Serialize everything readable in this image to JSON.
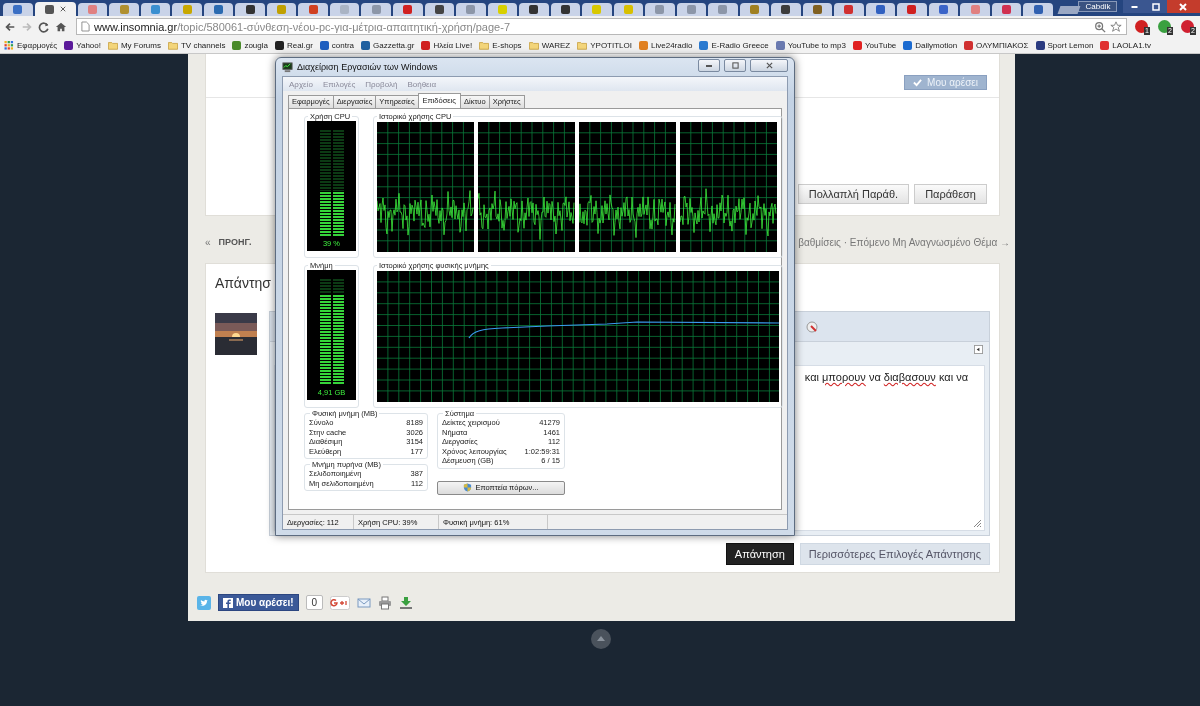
{
  "browser": {
    "tabs": [
      {
        "selected": false,
        "color": "#3a6fc4"
      },
      {
        "selected": true,
        "color": "#555555"
      },
      {
        "selected": false,
        "color": "#e08080"
      },
      {
        "selected": false,
        "color": "#b09030"
      },
      {
        "selected": false,
        "color": "#3a8fd0"
      },
      {
        "selected": false,
        "color": "#c8a800"
      },
      {
        "selected": false,
        "color": "#2a6ab0"
      },
      {
        "selected": false,
        "color": "#333333"
      },
      {
        "selected": false,
        "color": "#c0a000"
      },
      {
        "selected": false,
        "color": "#d04020"
      },
      {
        "selected": false,
        "color": "#aab4c4"
      },
      {
        "selected": false,
        "color": "#8c96a8"
      },
      {
        "selected": false,
        "color": "#d02020"
      },
      {
        "selected": false,
        "color": "#444444"
      },
      {
        "selected": false,
        "color": "#8c96a8"
      },
      {
        "selected": false,
        "color": "#d8d000"
      },
      {
        "selected": false,
        "color": "#333333"
      },
      {
        "selected": false,
        "color": "#333333"
      },
      {
        "selected": false,
        "color": "#d8c800"
      },
      {
        "selected": false,
        "color": "#d8c000"
      },
      {
        "selected": false,
        "color": "#8c96a8"
      },
      {
        "selected": false,
        "color": "#8c96a8"
      },
      {
        "selected": false,
        "color": "#8c96a8"
      },
      {
        "selected": false,
        "color": "#a08020"
      },
      {
        "selected": false,
        "color": "#3c3c3c"
      },
      {
        "selected": false,
        "color": "#806020"
      },
      {
        "selected": false,
        "color": "#d03030"
      },
      {
        "selected": false,
        "color": "#3060c0"
      },
      {
        "selected": false,
        "color": "#d02020"
      },
      {
        "selected": false,
        "color": "#3a64c8"
      },
      {
        "selected": false,
        "color": "#e08080"
      },
      {
        "selected": false,
        "color": "#d03050"
      },
      {
        "selected": false,
        "color": "#3060b0"
      }
    ],
    "profile": "Cabdik",
    "url": {
      "host": "www.insomnia.gr",
      "path": "/topic/580061-σύνθεση-νέου-pc-για-μέτρια-απαιτητική-χρήση/page-7"
    },
    "extensions": [
      {
        "color": "#d02020",
        "badge": "1"
      },
      {
        "color": "#3aa040",
        "badge": "2"
      },
      {
        "color": "#d02030",
        "badge": "2"
      }
    ],
    "bookmarks": [
      {
        "kind": "apps",
        "label": "Εφαρμογές"
      },
      {
        "kind": "site",
        "label": "Yahoo!",
        "color": "#5b1a9a"
      },
      {
        "kind": "folder",
        "label": "My Forums"
      },
      {
        "kind": "folder",
        "label": "TV channels"
      },
      {
        "kind": "site",
        "label": "zougla",
        "color": "#4a8a2a"
      },
      {
        "kind": "site",
        "label": "Real.gr",
        "color": "#222222"
      },
      {
        "kind": "site",
        "label": "contra",
        "color": "#1f5fbf"
      },
      {
        "kind": "site",
        "label": "Gazzetta.gr",
        "color": "#2060a0"
      },
      {
        "kind": "site",
        "label": "Ηλεία Live!",
        "color": "#d02020"
      },
      {
        "kind": "folder",
        "label": "E-shops"
      },
      {
        "kind": "folder",
        "label": "WAREZ"
      },
      {
        "kind": "folder",
        "label": "YPOTITLOI"
      },
      {
        "kind": "site",
        "label": "Live24radio",
        "color": "#e08020"
      },
      {
        "kind": "site",
        "label": "E-Radio Greece",
        "color": "#2a7ad0"
      },
      {
        "kind": "site",
        "label": "YouTube to mp3",
        "color": "#6a7ab0"
      },
      {
        "kind": "site",
        "label": "YouTube",
        "color": "#e02020"
      },
      {
        "kind": "site",
        "label": "Dailymotion",
        "color": "#1a6ad0"
      },
      {
        "kind": "site",
        "label": "ΟΛΥΜΠΙΑΚΟΣ",
        "color": "#d03030"
      },
      {
        "kind": "site",
        "label": "Sport Lemon",
        "color": "#2a3a80"
      },
      {
        "kind": "site",
        "label": "LAOLA1.tv",
        "color": "#e03030"
      }
    ]
  },
  "post": {
    "like_button": "Μου αρέσει",
    "buttons": [
      "Πολλαπλή Παράθ.",
      "Παράθεση"
    ]
  },
  "navigation": {
    "back_arrow": "«",
    "previous": "ΠΡΟΗΓ.",
    "next": "βαθμίσεις · Επόμενο Μη Αναγνωσμένο Θέμα →"
  },
  "reply": {
    "heading": "Απάντησ",
    "editor_words": [
      {
        "text": "και",
        "misspelled": false
      },
      {
        "text": "μπορουν",
        "misspelled": true
      },
      {
        "text": "να",
        "misspelled": false
      },
      {
        "text": "διαβασουν",
        "misspelled": true
      },
      {
        "text": "και",
        "misspelled": false
      },
      {
        "text": "να",
        "misspelled": false
      }
    ],
    "buttons": [
      {
        "label": "Απάντηση",
        "primary": true
      },
      {
        "label": "Περισσότερες Επιλογές Απάντησης",
        "primary": false
      }
    ]
  },
  "share": {
    "like_button": "Μου αρέσει!",
    "like_count": "0"
  },
  "task_manager": {
    "title": "Διαχείριση Εργασιών των Windows",
    "menu": [
      "Αρχείο",
      "Επιλογές",
      "Προβολή",
      "Βοήθεια"
    ],
    "tabs": [
      {
        "label": "Εφαρμογές",
        "selected": false
      },
      {
        "label": "Διεργασίες",
        "selected": false
      },
      {
        "label": "Υπηρεσίες",
        "selected": false
      },
      {
        "label": "Επιδόσεις",
        "selected": true
      },
      {
        "label": "Δίκτυο",
        "selected": false
      },
      {
        "label": "Χρήστες",
        "selected": false
      }
    ],
    "cpu_usage": {
      "label": "Χρήση CPU",
      "level": 0.42,
      "reading": "39 %"
    },
    "cpu_history": {
      "label": "Ιστορικό χρήσης CPU"
    },
    "memory": {
      "label": "Μνήμη",
      "level": 0.85,
      "reading": "4,91 GB"
    },
    "memory_history": {
      "label": "Ιστορικό χρήσης φυσικής μνήμης"
    },
    "physical_memory": {
      "label": "Φυσική μνήμη (MB)",
      "rows": [
        {
          "name": "Σύνολο",
          "value": "8189"
        },
        {
          "name": "Στην cache",
          "value": "3026"
        },
        {
          "name": "Διαθέσιμη",
          "value": "3154"
        },
        {
          "name": "Ελεύθερη",
          "value": "177"
        }
      ]
    },
    "kernel_memory": {
      "label": "Μνήμη πυρήνα (MB)",
      "rows": [
        {
          "name": "Σελιδοποιημένη",
          "value": "387"
        },
        {
          "name": "Μη σελιδοποιημένη",
          "value": "112"
        }
      ]
    },
    "system": {
      "label": "Σύστημα",
      "rows": [
        {
          "name": "Δείκτες χειρισμού",
          "value": "41279"
        },
        {
          "name": "Νήματα",
          "value": "1461"
        },
        {
          "name": "Διεργασίες",
          "value": "112"
        },
        {
          "name": "Χρόνος λειτουργίας",
          "value": "1:02:59:31"
        },
        {
          "name": "Δέσμευση (GB)",
          "value": "6 / 15"
        }
      ]
    },
    "resource_monitor_button": "Εποπτεία πόρων...",
    "status_bar": [
      "Διεργασίες: 112",
      "Χρήση CPU: 39%",
      "Φυσική μνήμη: 61%"
    ]
  }
}
